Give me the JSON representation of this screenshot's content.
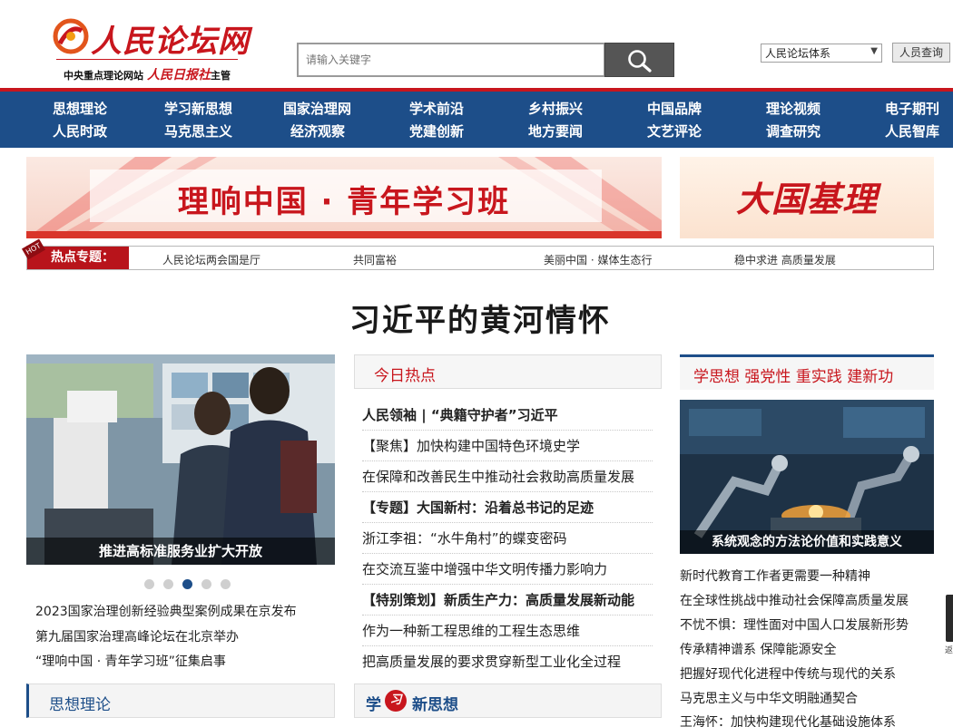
{
  "header": {
    "logo_title": "人民论坛网",
    "logo_sub": "中央重点理论网站",
    "logo_paper": "人民日报社",
    "logo_suffix": "主管",
    "search_placeholder": "请输入关键字",
    "system_select": "人民论坛体系",
    "staff_query": "人员查询"
  },
  "nav": {
    "row1": [
      "思想理论",
      "学习新思想",
      "国家治理网",
      "学术前沿",
      "乡村振兴",
      "中国品牌",
      "理论视频",
      "电子期刊"
    ],
    "row2": [
      "人民时政",
      "马克思主义",
      "经济观察",
      "党建创新",
      "地方要闻",
      "文艺评论",
      "调查研究",
      "人民智库"
    ]
  },
  "banners": {
    "main": "理响中国 · 青年学习班",
    "side": "大国基理"
  },
  "hot_topics": {
    "tag": "HOT",
    "label": "热点专题：",
    "items": [
      "人民论坛两会国是厅",
      "共同富裕",
      "美丽中国 · 媒体生态行",
      "稳中求进 高质量发展"
    ]
  },
  "headline": "习近平的黄河情怀",
  "left": {
    "photo_caption": "推进高标准服务业扩大开放",
    "dots_total": 5,
    "dots_active": 3,
    "links": [
      "2023国家治理创新经验典型案例成果在京发布",
      "第九届国家治理高峰论坛在北京举办",
      "“理响中国 · 青年学习班”征集启事"
    ],
    "tab": "思想理论"
  },
  "middle": {
    "title": "今日热点",
    "items": [
      {
        "text": "人民领袖 | “典籍守护者”习近平",
        "bold": true
      },
      {
        "text": "【聚焦】加快构建中国特色环境史学",
        "bold": false
      },
      {
        "text": "在保障和改善民生中推动社会救助高质量发展",
        "bold": false
      },
      {
        "text": "【专题】大国新村：沿着总书记的足迹",
        "bold": true
      },
      {
        "text": "浙江李祖：“水牛角村”的蝶变密码",
        "bold": false
      },
      {
        "text": "在交流互鉴中增强中华文明传播力影响力",
        "bold": false
      },
      {
        "text": "【特别策划】新质生产力：高质量发展新动能",
        "bold": true
      },
      {
        "text": "作为一种新工程思维的工程生态思维",
        "bold": false
      },
      {
        "text": "把高质量发展的要求贯穿新型工业化全过程",
        "bold": false
      }
    ],
    "tab_1": "学",
    "tab_badge": "习",
    "tab_2": "新思想"
  },
  "right": {
    "title": "学思想 强党性 重实践 建新功",
    "photo_caption": "系统观念的方法论价值和实践意义",
    "links": [
      "新时代教育工作者更需要一种精神",
      "在全球性挑战中推动社会保障高质量发展",
      "不忧不惧：理性面对中国人口发展新形势",
      "传承精神谱系  保障能源安全",
      "把握好现代化进程中传统与现代的关系",
      "马克思主义与中华文明融通契合",
      "王海怀：加快构建现代化基础设施体系"
    ]
  },
  "side_widget": {
    "label": "返"
  },
  "colors": {
    "brand_red": "#c8161d",
    "nav_blue": "#1d4e89"
  }
}
